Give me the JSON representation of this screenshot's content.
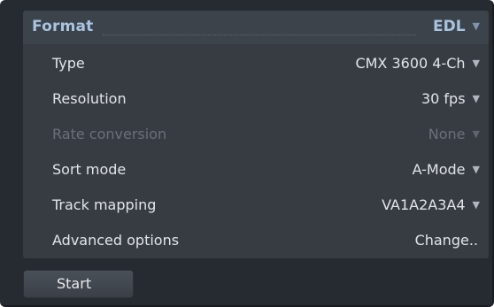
{
  "format": {
    "label": "Format",
    "value": "EDL",
    "arrow": "▼"
  },
  "rows": [
    {
      "label": "Type",
      "value": "CMX 3600 4-Ch",
      "arrow": "▼",
      "enabled": true
    },
    {
      "label": "Resolution",
      "value": "30 fps",
      "arrow": "▼",
      "enabled": true
    },
    {
      "label": "Rate conversion",
      "value": "None",
      "arrow": "▼",
      "enabled": false
    },
    {
      "label": "Sort mode",
      "value": "A-Mode",
      "arrow": "▼",
      "enabled": true
    },
    {
      "label": "Track mapping",
      "value": "VA1A2A3A4",
      "arrow": "▼",
      "enabled": true
    },
    {
      "label": "Advanced options",
      "value": "Change..",
      "enabled": true
    }
  ],
  "start_button": {
    "label": "Start"
  },
  "colors": {
    "background": "#262b32",
    "panel": "#373c43",
    "header_accent": "#a8c4e0",
    "text": "#e2e5e8",
    "disabled_text": "#6a7078"
  }
}
